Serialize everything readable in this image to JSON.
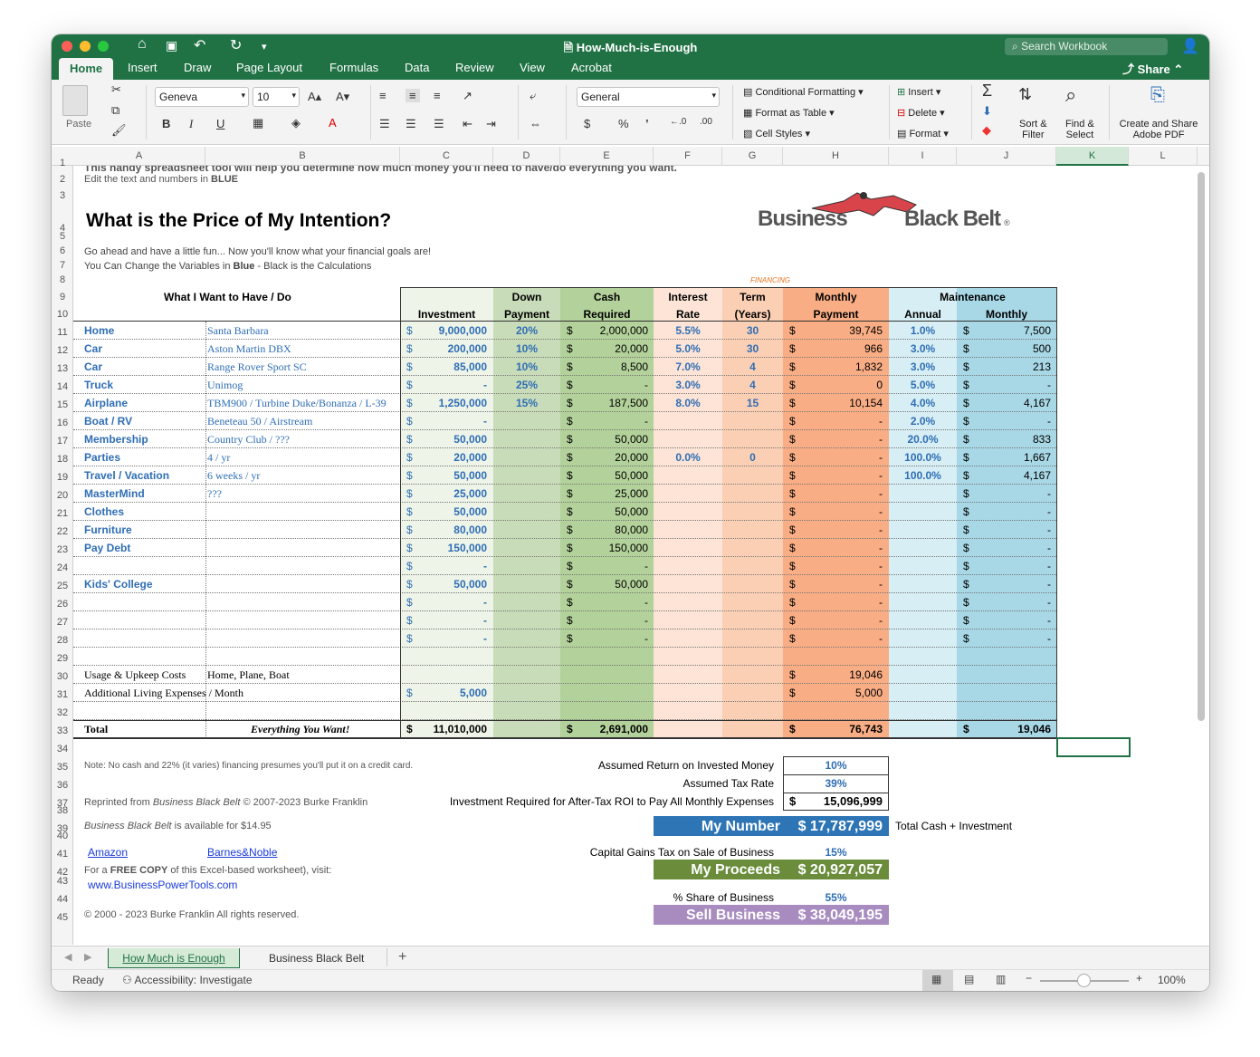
{
  "window": {
    "title": "How-Much-is-Enough",
    "search_placeholder": "Search Workbook",
    "share": "Share"
  },
  "menu_tabs": [
    "Home",
    "Insert",
    "Draw",
    "Page Layout",
    "Formulas",
    "Data",
    "Review",
    "View",
    "Acrobat"
  ],
  "ribbon": {
    "paste": "Paste",
    "font": "Geneva",
    "size": "10",
    "number_format": "General",
    "conditional": "Conditional Formatting",
    "format_table": "Format as Table",
    "cell_styles": "Cell Styles",
    "insert": "Insert",
    "delete": "Delete",
    "format": "Format",
    "sort": "Sort &",
    "filter": "Filter",
    "find": "Find &",
    "select": "Select",
    "create_share": "Create and Share",
    "adobe_pdf": "Adobe PDF",
    "bold": "B",
    "italic": "I",
    "underline": "U",
    "dollar": "$",
    "percent": "%",
    "comma": "’"
  },
  "columns": [
    "A",
    "B",
    "C",
    "D",
    "E",
    "F",
    "G",
    "H",
    "I",
    "J",
    "K",
    "L"
  ],
  "rows": [
    "1",
    "2",
    "3",
    "4",
    "5",
    "6",
    "7",
    "8",
    "9",
    "10",
    "11",
    "12",
    "13",
    "14",
    "15",
    "16",
    "17",
    "18",
    "19",
    "20",
    "21",
    "22",
    "23",
    "24",
    "25",
    "26",
    "27",
    "28",
    "29",
    "30",
    "31",
    "32",
    "33",
    "34",
    "35",
    "36",
    "37",
    "38",
    "39",
    "40",
    "41",
    "42",
    "43",
    "44",
    "45"
  ],
  "sheet": {
    "intro": "This handy spreadsheet tool will help you determine how much money you'll need to have/do everything you want.",
    "edit_prefix": "Edit the text and numbers in ",
    "edit_blue": "BLUE",
    "title": "What is the Price of My Intention?",
    "logo_left": "Business",
    "logo_right": "Black Belt",
    "logo_mark": "®",
    "fun": "Go ahead and have a little fun... Now you'll know what your financial goals are!",
    "change_a": "You Can Change the Variables in ",
    "change_b": "Blue",
    " change_c": " - Black is the Calculations",
    "financing": "FINANCING",
    "h_want": "What I Want to Have / Do",
    "h_investment": "Investment",
    "h_down1": "Down",
    "h_down2": "Payment",
    "h_cash1": "Cash",
    "h_cash2": "Required",
    "h_int1": "Interest",
    "h_int2": "Rate",
    "h_term1": "Term",
    "h_term2": "(Years)",
    "h_mon1": "Monthly",
    "h_mon2": "Payment",
    "h_maint": "Maintenance",
    "h_annual": "Annual",
    "h_monthly": "Monthly",
    "items": [
      {
        "a": "Home",
        "b": "Santa Barbara",
        "c": "9,000,000",
        "d": "20%",
        "e": "2,000,000",
        "f": "5.5%",
        "g": "30",
        "h": "39,745",
        "i": "1.0%",
        "j": "7,500"
      },
      {
        "a": "Car",
        "b": "Aston Martin DBX",
        "c": "200,000",
        "d": "10%",
        "e": "20,000",
        "f": "5.0%",
        "g": "30",
        "h": "966",
        "i": "3.0%",
        "j": "500"
      },
      {
        "a": "Car",
        "b": "Range Rover Sport SC",
        "c": "85,000",
        "d": "10%",
        "e": "8,500",
        "f": "7.0%",
        "g": "4",
        "h": "1,832",
        "i": "3.0%",
        "j": "213"
      },
      {
        "a": "Truck",
        "b": "Unimog",
        "c": "-",
        "d": "25%",
        "e": "-",
        "f": "3.0%",
        "g": "4",
        "h": "0",
        "i": "5.0%",
        "j": "-"
      },
      {
        "a": "Airplane",
        "b": "TBM900 / Turbine Duke/Bonanza / L-39",
        "c": "1,250,000",
        "d": "15%",
        "e": "187,500",
        "f": "8.0%",
        "g": "15",
        "h": "10,154",
        "i": "4.0%",
        "j": "4,167"
      },
      {
        "a": "Boat / RV",
        "b": "Beneteau 50 / Airstream",
        "c": "-",
        "d": "",
        "e": "-",
        "f": "",
        "g": "",
        "h": "-",
        "i": "2.0%",
        "j": "-"
      },
      {
        "a": "Membership",
        "b": "Country Club / ???",
        "c": "50,000",
        "d": "",
        "e": "50,000",
        "f": "",
        "g": "",
        "h": "-",
        "i": "20.0%",
        "j": "833"
      },
      {
        "a": "Parties",
        "b": "4 / yr",
        "c": "20,000",
        "d": "",
        "e": "20,000",
        "f": "0.0%",
        "g": "0",
        "h": "-",
        "i": "100.0%",
        "j": "1,667"
      },
      {
        "a": "Travel / Vacation",
        "b": "6 weeks / yr",
        "c": "50,000",
        "d": "",
        "e": "50,000",
        "f": "",
        "g": "",
        "h": "-",
        "i": "100.0%",
        "j": "4,167"
      },
      {
        "a": "MasterMind",
        "b": "???",
        "c": "25,000",
        "d": "",
        "e": "25,000",
        "f": "",
        "g": "",
        "h": "-",
        "i": "",
        "j": "-"
      },
      {
        "a": "Clothes",
        "b": "",
        "c": "50,000",
        "d": "",
        "e": "50,000",
        "f": "",
        "g": "",
        "h": "-",
        "i": "",
        "j": "-"
      },
      {
        "a": "Furniture",
        "b": "",
        "c": "80,000",
        "d": "",
        "e": "80,000",
        "f": "",
        "g": "",
        "h": "-",
        "i": "",
        "j": "-"
      },
      {
        "a": "Pay Debt",
        "b": "",
        "c": "150,000",
        "d": "",
        "e": "150,000",
        "f": "",
        "g": "",
        "h": "-",
        "i": "",
        "j": "-"
      },
      {
        "a": "",
        "b": "",
        "c": "-",
        "d": "",
        "e": "-",
        "f": "",
        "g": "",
        "h": "-",
        "i": "",
        "j": "-"
      },
      {
        "a": "Kids' College",
        "b": "",
        "c": "50,000",
        "d": "",
        "e": "50,000",
        "f": "",
        "g": "",
        "h": "-",
        "i": "",
        "j": "-"
      },
      {
        "a": "",
        "b": "",
        "c": "-",
        "d": "",
        "e": "-",
        "f": "",
        "g": "",
        "h": "-",
        "i": "",
        "j": "-"
      },
      {
        "a": "",
        "b": "",
        "c": "-",
        "d": "",
        "e": "-",
        "f": "",
        "g": "",
        "h": "-",
        "i": "",
        "j": "-"
      },
      {
        "a": "",
        "b": "",
        "c": "-",
        "d": "",
        "e": "-",
        "f": "",
        "g": "",
        "h": "-",
        "i": "",
        "j": "-"
      }
    ],
    "dollar": "$",
    "upkeep_a": "Usage & Upkeep Costs",
    "upkeep_b": "Home, Plane, Boat",
    "upkeep_h": "19,046",
    "living_a": "Additional Living Expenses / Month",
    "living_c": "5,000",
    "living_h": "5,000",
    "total_a": "Total",
    "total_b": "Everything You Want!",
    "total_c": "11,010,000",
    "total_e": "2,691,000",
    "total_h": "76,743",
    "total_j": "19,046",
    "note": "Note: No cash and 22% (it varies) financing presumes you'll put it on a credit card.",
    "reprinted_a": "Reprinted from ",
    "reprinted_b": "Business Black Belt",
    " reprinted_c": " © 2007-2023 Burke Franklin",
    "avail_a": "Business Black Belt",
    "avail_b": " is available for $14.95",
    "amazon": "Amazon",
    "bn": "Barnes&Noble",
    "free_a": "For a ",
    "free_b": "FREE COPY",
    "free_c": " of this Excel-based worksheet), visit:",
    "url": "www.BusinessPowerTools.com",
    "copyright": "© 2000 - 2023 Burke Franklin All rights reserved.",
    "ret_label": "Assumed Return on Invested Money",
    "ret_val": "10%",
    "tax_label": "Assumed Tax Rate",
    "tax_val": "39%",
    "inv_label": "Investment Required for After-Tax ROI to Pay All Monthly Expenses",
    "inv_val": "15,096,999",
    "mynum_label": "My Number",
    "mynum_val": "$  17,787,999",
    "mynum_note": "Total Cash + Investment",
    "cg_label": "Capital Gains Tax on Sale of Business",
    "cg_val": "15%",
    "proc_label": "My Proceeds",
    "proc_val": "$  20,927,057",
    "share_label": "% Share of Business",
    "share_val": "55%",
    "sell_label": "Sell Business",
    "sell_val": "$  38,049,195"
  },
  "sheet_tabs": {
    "active": "How Much is Enough",
    "other": "Business Black Belt",
    "add": "+"
  },
  "status": {
    "ready": "Ready",
    "access": "Accessibility: Investigate",
    "zoom": "100%"
  },
  "colors": {
    "green": "#207245",
    "down": "#c9dcb9",
    "cash": "#b3d19a",
    "interest": "#fde4d6",
    "term": "#fbcfb4",
    "monthly": "#f8ad84",
    "annual": "#d6eef4",
    "mmonthly": "#a8d8e6",
    "mynumber": "#2e75b6",
    "proceeds": "#6a8c3b",
    "sell": "#a88cc0"
  }
}
